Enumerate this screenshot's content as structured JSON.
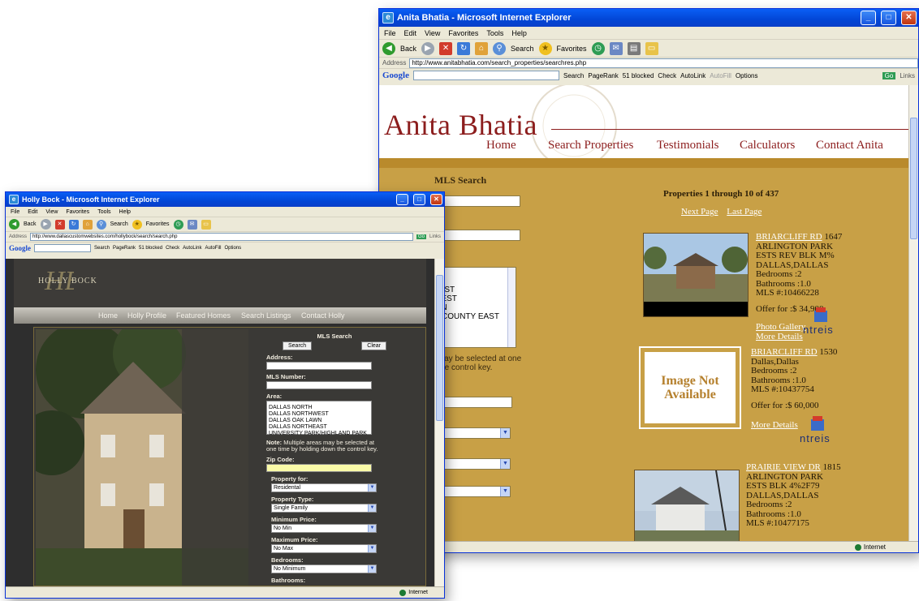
{
  "anita_window": {
    "title": "Anita Bhatia - Microsoft Internet Explorer",
    "menu": [
      "File",
      "Edit",
      "View",
      "Favorites",
      "Tools",
      "Help"
    ],
    "toolbar": {
      "back": "Back",
      "search": "Search",
      "favorites": "Favorites"
    },
    "address_label": "Address",
    "address": "http://www.anitabhatia.com/search_properties/searchres.php",
    "go_label": "Go",
    "links_label": "Links",
    "google": {
      "logo": "Google",
      "search": "Search",
      "pagerank": "PageRank",
      "blocked": "51 blocked",
      "check": "Check",
      "autolink": "AutoLink",
      "autofill": "AutoFill",
      "options": "Options"
    },
    "status": "Internet",
    "site": {
      "logo": "Anita Bhatia",
      "nav": [
        "Home",
        "Search Properties",
        "Testimonials",
        "Calculators",
        "Contact Anita"
      ],
      "search_heading": "MLS Search",
      "area_partial": [
        "EAST",
        "WEST",
        "WN",
        "N COUNTY EAST",
        "",
        "TY"
      ],
      "note_partial": "s may be selected at one\nn the control key.",
      "results_title": "Properties 1 through 10 of 437",
      "next_page": "Next Page",
      "last_page": "Last Page",
      "properties": [
        {
          "street": "BRIARCLIFF RD",
          "number": "1647",
          "lines": [
            "ARLINGTON PARK",
            "ESTS REV BLK M%",
            "DALLAS,DALLAS",
            "Bedrooms :2",
            "Bathrooms :1.0",
            "MLS #:10466228"
          ],
          "offer": "Offer for :$ 34,900",
          "links": [
            "Photo Gallery",
            "More Details"
          ]
        },
        {
          "street": "BRIARCLIFF RD",
          "number": "1530",
          "lines": [
            "Dallas,Dallas",
            "Bedrooms :2",
            "Bathrooms :1.0",
            "MLS #:10437754"
          ],
          "offer": "Offer for :$ 60,000",
          "links": [
            "More Details"
          ]
        },
        {
          "street": "PRAIRIE VIEW DR",
          "number": "1815",
          "lines": [
            "ARLINGTON PARK",
            "ESTS BLK 4%2F79",
            "DALLAS,DALLAS",
            "Bedrooms :2",
            "Bathrooms :1.0",
            "MLS #:10477175"
          ],
          "offer": "",
          "links": []
        }
      ],
      "no_image": "Image Not Available",
      "ntreis": "ntreis"
    }
  },
  "holly_window": {
    "title": "Holly Bock - Microsoft Internet Explorer",
    "menu": [
      "File",
      "Edit",
      "View",
      "Favorites",
      "Tools",
      "Help"
    ],
    "toolbar": {
      "back": "Back",
      "search": "Search",
      "favorites": "Favorites"
    },
    "address_label": "Address",
    "address": "http://www.dallascustomwebsites.com/hollybock/search/search.php",
    "go_label": "Go",
    "links_label": "Links",
    "google": {
      "logo": "Google",
      "search": "Search",
      "pagerank": "PageRank",
      "blocked": "51 blocked",
      "check": "Check",
      "autolink": "AutoLink",
      "autofill": "AutoFill",
      "options": "Options"
    },
    "status": "Internet",
    "site": {
      "logo": "HOLLY BOCK",
      "nav": [
        "Home",
        "Holly Profile",
        "Featured Homes",
        "Search Listings",
        "Contact Holly"
      ],
      "form_title": "MLS Search",
      "search_btn": "Search",
      "clear_btn": "Clear",
      "address_label": "Address:",
      "mls_label": "MLS Number:",
      "area_label": "Area:",
      "areas": [
        "DALLAS NORTH",
        "DALLAS NORTHWEST",
        "DALLAS OAK LAWN",
        "DALLAS NORTHEAST",
        "UNIVERSITY PARK/HIGHLAND PARK"
      ],
      "note_label": "Note:",
      "note": "Multiple areas may be selected at one time by holding down the control key.",
      "zip_label": "Zip Code:",
      "property_for_label": "Property for:",
      "property_for": "Residental",
      "property_type_label": "Property Type:",
      "property_type": "Single Family",
      "min_price_label": "Minimum Price:",
      "min_price": "No Min",
      "max_price_label": "Maximum Price:",
      "max_price": "No Max",
      "bedrooms_label": "Bedrooms:",
      "bedrooms": "No Minimum",
      "bathrooms_label": "Bathrooms:"
    }
  },
  "colors": {
    "ie_blue": "#0a5ff5",
    "anita_gold": "#c8a046",
    "anita_red": "#8c1d1d",
    "holly_dark": "#2e2e2e"
  }
}
